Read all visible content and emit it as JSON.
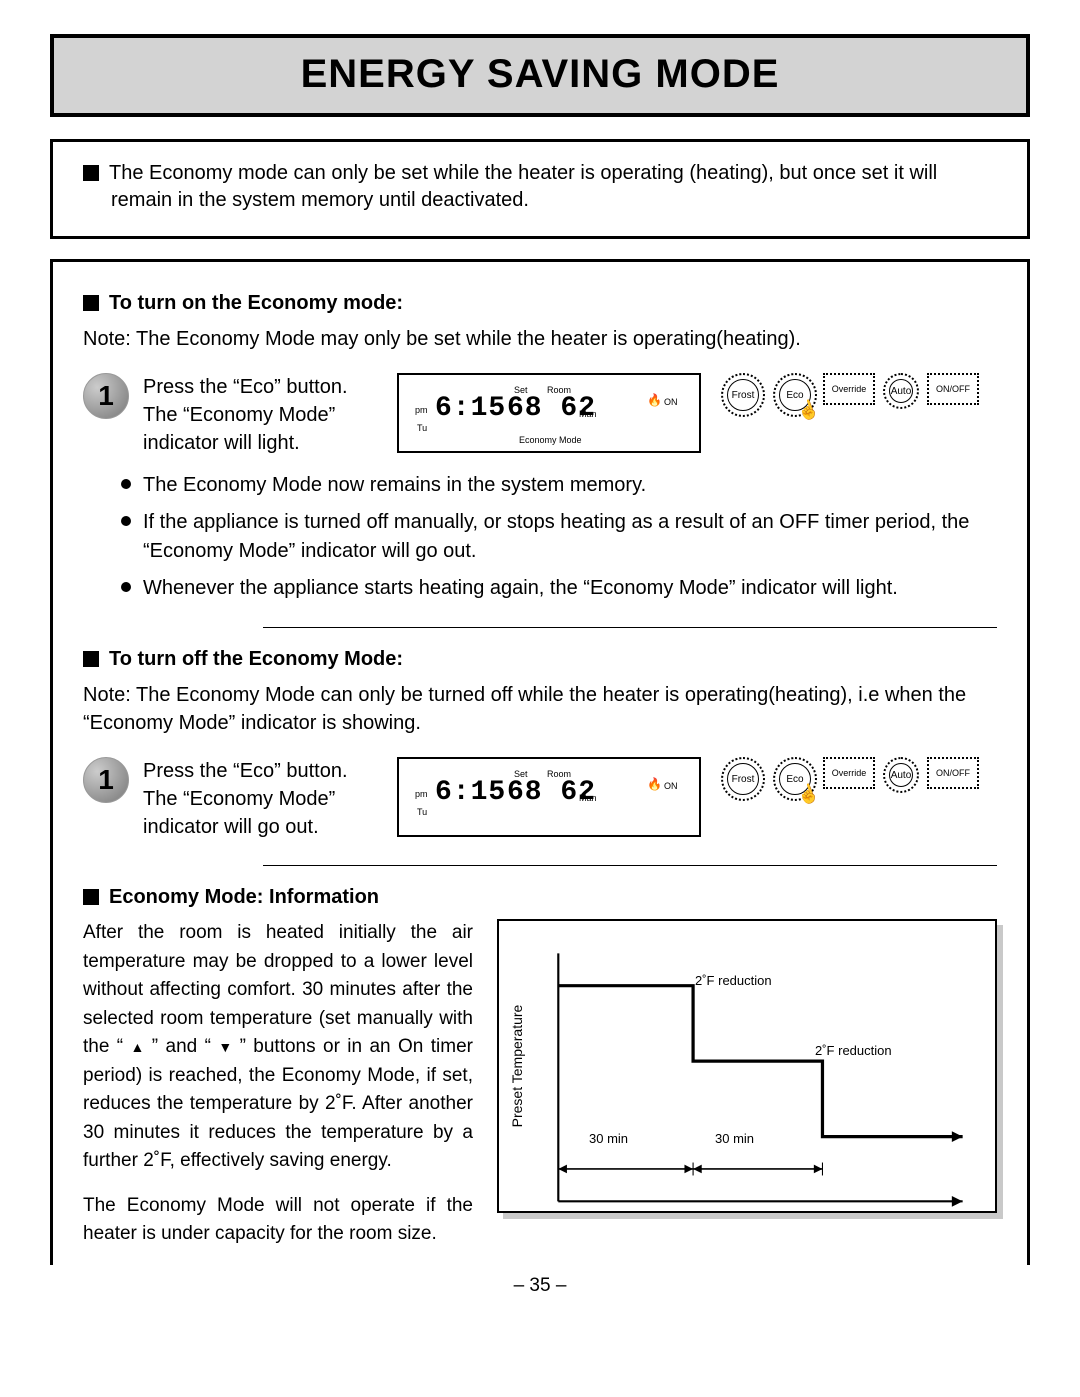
{
  "header": {
    "title": "ENERGY SAVING MODE"
  },
  "intro": {
    "line1": "The Economy mode can only be set while the heater is operating (heating), but once set it will",
    "line2": "remain in the system memory until deactivated."
  },
  "section_on": {
    "title": "To turn on the Economy mode:",
    "note": "Note: The Economy Mode may only be set while the heater is operating(heating).",
    "step_num": "1",
    "step_text": "Press the “Eco” button. The “Economy Mode” indicator will light.",
    "bullets": [
      "The Economy Mode now remains in the system memory.",
      "If the appliance is turned off manually, or stops heating as a result of an OFF timer period, the “Economy Mode” indicator will go out.",
      "Whenever the appliance starts heating again, the “Economy Mode” indicator will light."
    ]
  },
  "section_off": {
    "title": "To turn off the Economy Mode:",
    "note": "Note: The Economy Mode can only be turned off while the heater is operating(heating), i.e when the  “Economy Mode” indicator is showing.",
    "step_num": "1",
    "step_text": "Press the “Eco” button. The “Economy Mode” indicator will go out."
  },
  "lcd": {
    "pm": "pm",
    "tu": "Tu",
    "time": "6:15",
    "set_label": "Set",
    "room_label": "Room",
    "temps": "68 62",
    "man": "Man",
    "on": "ON",
    "eco_mode": "Economy Mode"
  },
  "buttons": {
    "frost": "Frost",
    "eco": "Eco",
    "override": "Override",
    "auto": "Auto",
    "onoff": "ON/OFF"
  },
  "section_info": {
    "title": "Economy Mode: Information",
    "para1_a": "After the room is heated initially the air temperature may be dropped to a lower level without affecting comfort. 30 minutes after the selected room temperature (set manually with the “ ",
    "para1_b": " ” and “ ",
    "para1_c": " ” buttons or in an On timer period) is reached, the Economy Mode, if set, reduces the temperature by 2˚F. After another 30 minutes it reduces the temperature by a further 2˚F, effectively saving energy.",
    "para2": "The Economy Mode will not operate if the heater is under capacity for the room size.",
    "ylabel": "Preset Temperature",
    "label_reduction1": "2˚F reduction",
    "label_reduction2": "2˚F reduction",
    "label_30min_a": "30 min",
    "label_30min_b": "30 min"
  },
  "chart_data": {
    "type": "line",
    "title": "",
    "xlabel": "",
    "ylabel": "Preset Temperature",
    "annotations": [
      "2˚F reduction",
      "2˚F reduction",
      "30 min",
      "30 min"
    ],
    "x": [
      0,
      30,
      30,
      60,
      60,
      90
    ],
    "y_relative_f": [
      0,
      0,
      -2,
      -2,
      -4,
      -4
    ],
    "note": "y values are reductions in °F from the preset temperature over time (minutes)"
  },
  "footer": {
    "page": "– 35 –"
  }
}
